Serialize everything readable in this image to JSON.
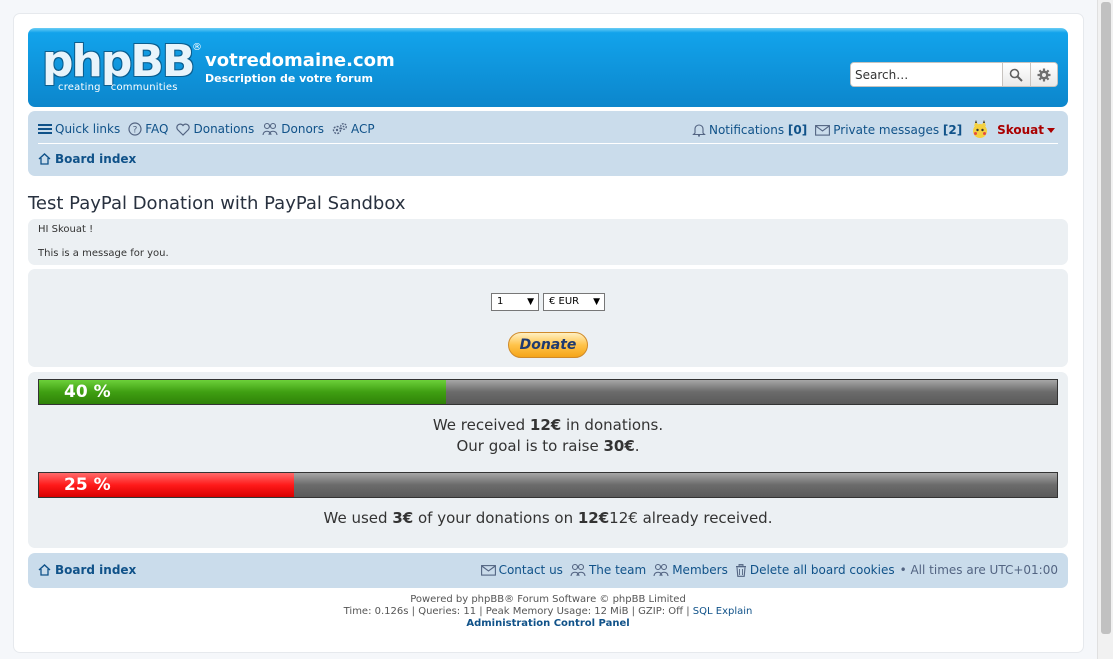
{
  "header": {
    "logo_text": "phpBB",
    "logo_reg": "®",
    "logo_tagline": "creating   communities",
    "site_name": "votredomaine.com",
    "site_description": "Description de votre forum",
    "search_placeholder": "Search…"
  },
  "nav": {
    "quick_links": "Quick links",
    "faq": "FAQ",
    "donations": "Donations",
    "donors": "Donors",
    "acp": "ACP",
    "notifications_label": "Notifications",
    "notifications_count": "[0]",
    "pm_label": "Private messages",
    "pm_count": "[2]",
    "username": "Skouat",
    "board_index": "Board index"
  },
  "topic": {
    "title": "Test PayPal Donation with PayPal Sandbox",
    "greeting": "HI Skouat !",
    "message": "This is a message for you."
  },
  "donate_form": {
    "amount_value": "1",
    "currency_value": "€ EUR",
    "donate_label": "Donate"
  },
  "stats": {
    "goal_bar": {
      "percent": 40,
      "label": "40 %"
    },
    "used_bar": {
      "percent": 25,
      "label": "25 %"
    },
    "received_prefix": "We received ",
    "received_amount": "12€",
    "received_suffix": " in donations.",
    "goal_prefix": "Our goal is to raise ",
    "goal_amount": "30€",
    "goal_suffix": ".",
    "used_prefix": "We used ",
    "used_amount": "3€",
    "used_middle": " of your donations on ",
    "used_base": "12€",
    "used_suffix": "12€ already received."
  },
  "footer": {
    "board_index": "Board index",
    "contact_us": "Contact us",
    "the_team": "The team",
    "members": "Members",
    "delete_cookies": "Delete all board cookies",
    "timezone": "• All times are UTC+01:00",
    "powered_by": "Powered by phpBB® Forum Software © phpBB Limited",
    "debug_prefix": "Time: 0.126s | Queries: 11 | Peak Memory Usage: 12 MiB | GZIP: Off | ",
    "sql_explain": "SQL Explain",
    "acp_link": "Administration Control Panel"
  },
  "colors": {
    "header_blue": "#0c86cc",
    "nav_bg": "#cadceb",
    "link": "#105289",
    "username": "#aa0000",
    "progress_green": "#3f9f12",
    "progress_red": "#ff1a1a"
  }
}
